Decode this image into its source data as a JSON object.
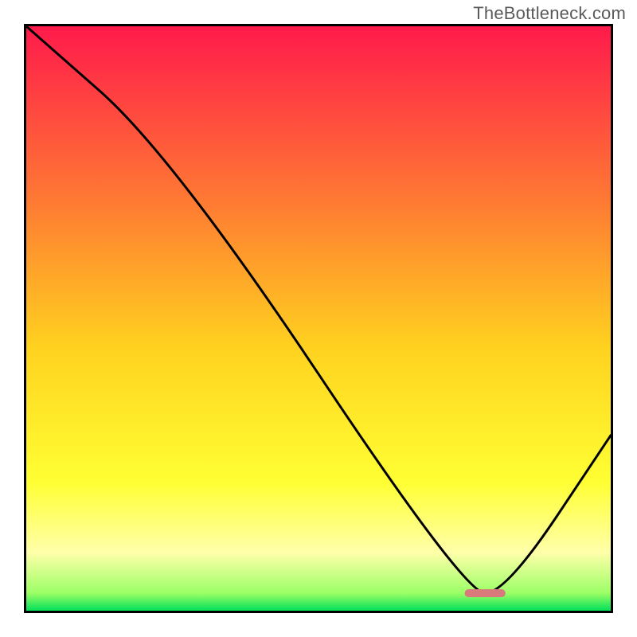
{
  "watermark": "TheBottleneck.com",
  "chart_data": {
    "type": "line",
    "title": "",
    "xlabel": "",
    "ylabel": "",
    "xlim": [
      0,
      100
    ],
    "ylim": [
      0,
      100
    ],
    "series": [
      {
        "name": "bottleneck-curve",
        "x": [
          0,
          25,
          75,
          82,
          100
        ],
        "y": [
          100,
          78,
          3,
          3,
          30
        ]
      }
    ],
    "marker": {
      "name": "optimal-range-marker",
      "x_start": 75,
      "x_end": 82,
      "y": 3,
      "color": "#d87a7c"
    },
    "gradient_stops": [
      {
        "offset": 0.0,
        "color": "#ff1a4b"
      },
      {
        "offset": 0.3,
        "color": "#ff7a33"
      },
      {
        "offset": 0.55,
        "color": "#ffd21f"
      },
      {
        "offset": 0.78,
        "color": "#ffff33"
      },
      {
        "offset": 0.9,
        "color": "#ffffaa"
      },
      {
        "offset": 0.97,
        "color": "#9cff66"
      },
      {
        "offset": 1.0,
        "color": "#00e05a"
      }
    ]
  }
}
